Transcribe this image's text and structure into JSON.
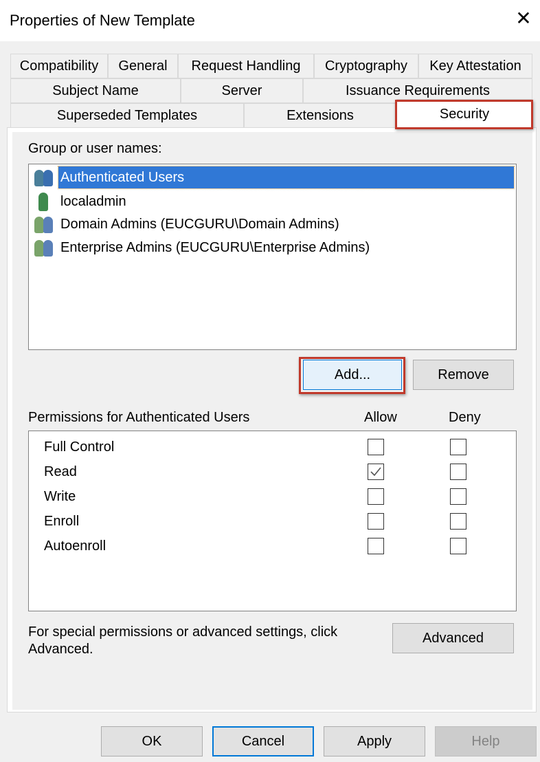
{
  "window": {
    "title": "Properties of New Template",
    "close_icon": "close-icon"
  },
  "tabs": {
    "row1": [
      "Compatibility",
      "General",
      "Request Handling",
      "Cryptography",
      "Key Attestation"
    ],
    "row2": [
      "Subject Name",
      "Server",
      "Issuance Requirements"
    ],
    "row3": [
      "Superseded Templates",
      "Extensions",
      "Security"
    ],
    "selected": "Security"
  },
  "security": {
    "group_label": "Group or user names:",
    "users": [
      {
        "name": "Authenticated Users",
        "icon": "group-icon",
        "selected": true
      },
      {
        "name": "localadmin",
        "icon": "user-icon",
        "selected": false
      },
      {
        "name": "Domain Admins (EUCGURU\\Domain Admins)",
        "icon": "group-icon",
        "selected": false
      },
      {
        "name": "Enterprise Admins (EUCGURU\\Enterprise Admins)",
        "icon": "group-icon",
        "selected": false
      }
    ],
    "add_label": "Add...",
    "remove_label": "Remove",
    "permissions_label": "Permissions for Authenticated Users",
    "allow_header": "Allow",
    "deny_header": "Deny",
    "permissions": [
      {
        "name": "Full Control",
        "allow": false,
        "deny": false
      },
      {
        "name": "Read",
        "allow": true,
        "deny": false
      },
      {
        "name": "Write",
        "allow": false,
        "deny": false
      },
      {
        "name": "Enroll",
        "allow": false,
        "deny": false
      },
      {
        "name": "Autoenroll",
        "allow": false,
        "deny": false
      }
    ],
    "advanced_text_1": "For special permissions or advanced settings, click",
    "advanced_text_2": "Advanced.",
    "advanced_label": "Advanced"
  },
  "footer": {
    "ok": "OK",
    "cancel": "Cancel",
    "apply": "Apply",
    "help": "Help"
  },
  "colors": {
    "selection": "#3078d6",
    "highlight": "#c0392b",
    "focus_border": "#0078d7"
  }
}
